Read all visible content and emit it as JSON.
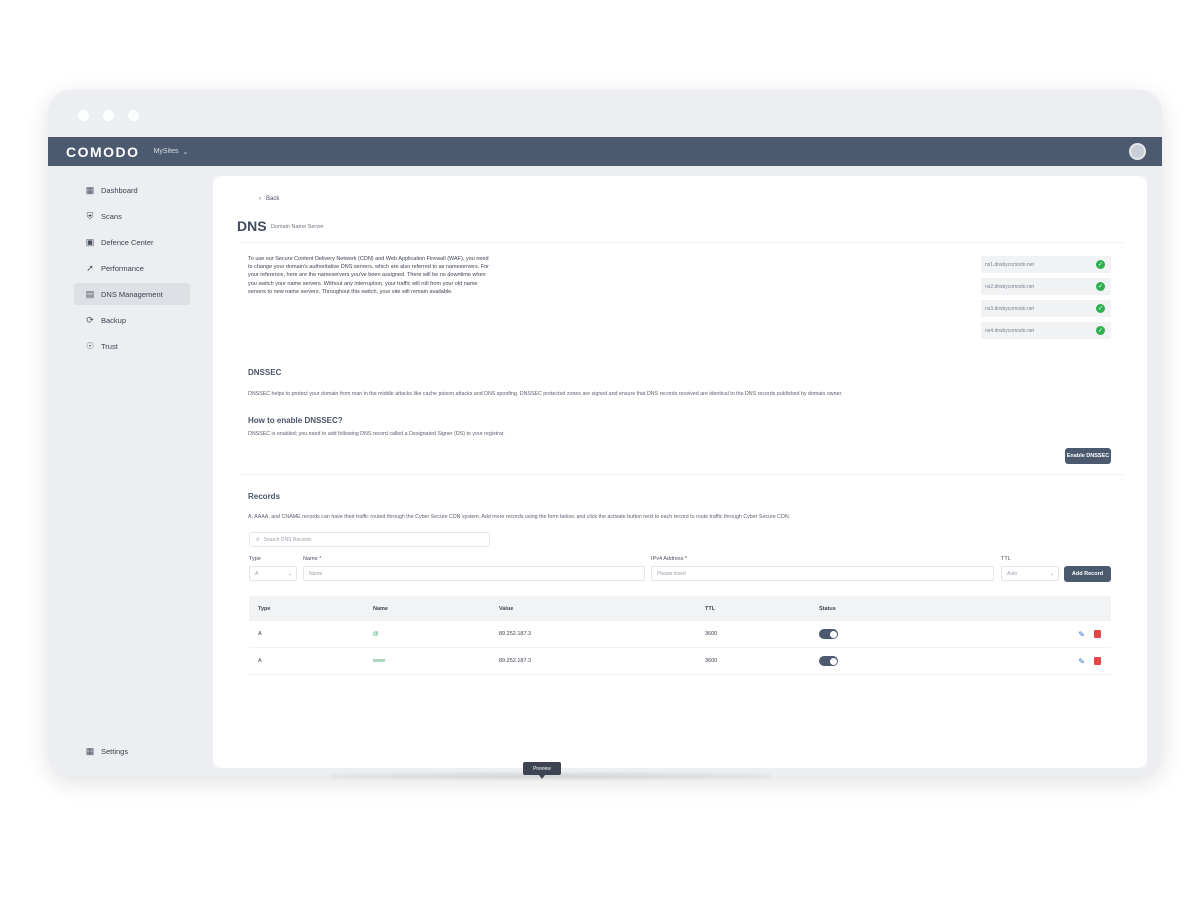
{
  "topbar": {
    "logo": "COMODO",
    "site": "MySites",
    "site_chevron": "chevron-down-icon"
  },
  "sidebar": {
    "items": [
      {
        "label": "Dashboard",
        "icon": "dashboard-icon"
      },
      {
        "label": "Scans",
        "icon": "shield-icon"
      },
      {
        "label": "Defence Center",
        "icon": "defence-icon"
      },
      {
        "label": "Performance",
        "icon": "rocket-icon"
      },
      {
        "label": "DNS Management",
        "icon": "dns-icon",
        "active": true
      },
      {
        "label": "Backup",
        "icon": "backup-icon"
      },
      {
        "label": "Trust",
        "icon": "trust-icon"
      }
    ],
    "settings": "Settings"
  },
  "page": {
    "back": "Back",
    "title": "DNS",
    "subtitle": "Domain Name Server",
    "intro": "To use our Secure Content Delivery Network (CDN) and Web Application Firewall (WAF), you need to change your domain's authoritative DNS servers, which are also referred to as nameservers. For your reference, here are the nameservers you've been assigned. There will be no downtime when you switch your name servers. Without any interruption, your traffic will roll from your old name servers to new name servers. Throughout this switch, your site will remain available.",
    "nameservers": [
      "ns1.dnsbycomodo.net",
      "ns2.dnsbycomodo.net",
      "ns3.dnsbycomodo.net",
      "ns4.dnsbycomodo.net"
    ]
  },
  "dnssec": {
    "title": "DNSSEC",
    "text": "DNSSEC helps to protect your domain from man in the middle attacks like cache poison attacks and DNS spoofing. DNSSEC protected zones are signed and ensure that DNS records received are identical to the DNS records published by domain owner.",
    "howto_title": "How to enable DNSSEC?",
    "howto_text": "DNSSEC is enabled; you need to add following DNS record called a Designated Signer (DS) to your registrar.",
    "enable_button": "Enable DNSSEC"
  },
  "records": {
    "title": "Records",
    "text": "A, AAAA, and CNAME records can have their traffic routed through the Cyber Secure CDN system. Add more records using the form below, and click the activate button next to each record to route traffic through Cyber Secure CDN.",
    "search_placeholder": "Search DNS Records",
    "form": {
      "type_label": "Type",
      "type_value": "A",
      "name_label": "Name *",
      "name_placeholder": "Name",
      "ipv4_label": "IPv4 Address *",
      "ipv4_placeholder": "Please insert",
      "ttl_label": "TTL",
      "ttl_value": "Auto",
      "add_button": "Add Record"
    },
    "columns": [
      "Type",
      "Name",
      "Value",
      "TTL",
      "Status"
    ],
    "rows": [
      {
        "type": "A",
        "name": "@",
        "value": "89.252.187.3",
        "ttl": "3600",
        "status": true
      },
      {
        "type": "A",
        "name": "www",
        "value": "89.252.187.3",
        "ttl": "3600",
        "status": true
      }
    ]
  },
  "preview_label": "Preview"
}
